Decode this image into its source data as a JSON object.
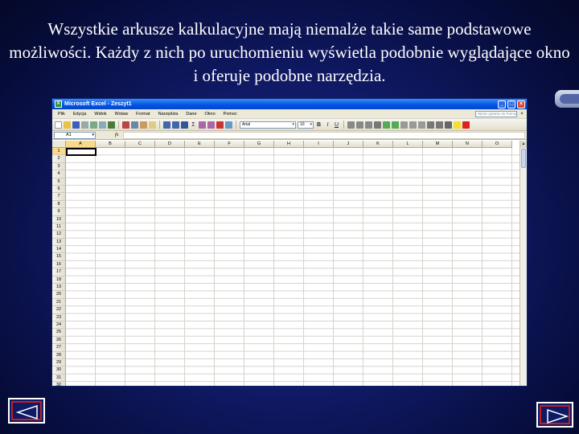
{
  "slide": {
    "title": "Wszystkie arkusze kalkulacyjne mają niemalże takie same podstawowe możliwości. Każdy z nich po uruchomieniu wyświetla podobnie wyglądające okno i oferuje podobne narzędzia."
  },
  "colors": {
    "background": "#101a66",
    "title_text": "#ffffff",
    "excel_titlebar": "#0054e3",
    "nav_border": "#c81e1e"
  },
  "excel": {
    "window_title": "Microsoft Excel - Zeszyt1",
    "window_buttons": [
      "_",
      "□",
      "×"
    ],
    "menu": [
      "Plik",
      "Edycja",
      "Widok",
      "Wstaw",
      "Format",
      "Narzędzia",
      "Dane",
      "Okno",
      "Pomoc"
    ],
    "help_placeholder": "Wpisz pytanie do Pomocy",
    "toolbar": {
      "font_name": "Arial",
      "font_size": "10",
      "sum_symbol": "Σ",
      "bold": "B",
      "italic": "I",
      "underline": "U"
    },
    "formula_bar": {
      "name_box": "A1",
      "fx_label": "fx"
    },
    "columns": [
      "A",
      "B",
      "C",
      "D",
      "E",
      "F",
      "G",
      "H",
      "I",
      "J",
      "K",
      "L",
      "M",
      "N",
      "O"
    ],
    "rows": [
      "1",
      "2",
      "3",
      "4",
      "5",
      "6",
      "7",
      "8",
      "9",
      "10",
      "11",
      "12",
      "13",
      "14",
      "15",
      "16",
      "17",
      "18",
      "19",
      "20",
      "21",
      "22",
      "23",
      "24",
      "25",
      "26",
      "27",
      "28",
      "29",
      "30",
      "31",
      "32"
    ],
    "active_cell": "A1"
  },
  "nav": {
    "prev_icon": "triangle-left-icon",
    "next_icon": "triangle-right-icon"
  }
}
